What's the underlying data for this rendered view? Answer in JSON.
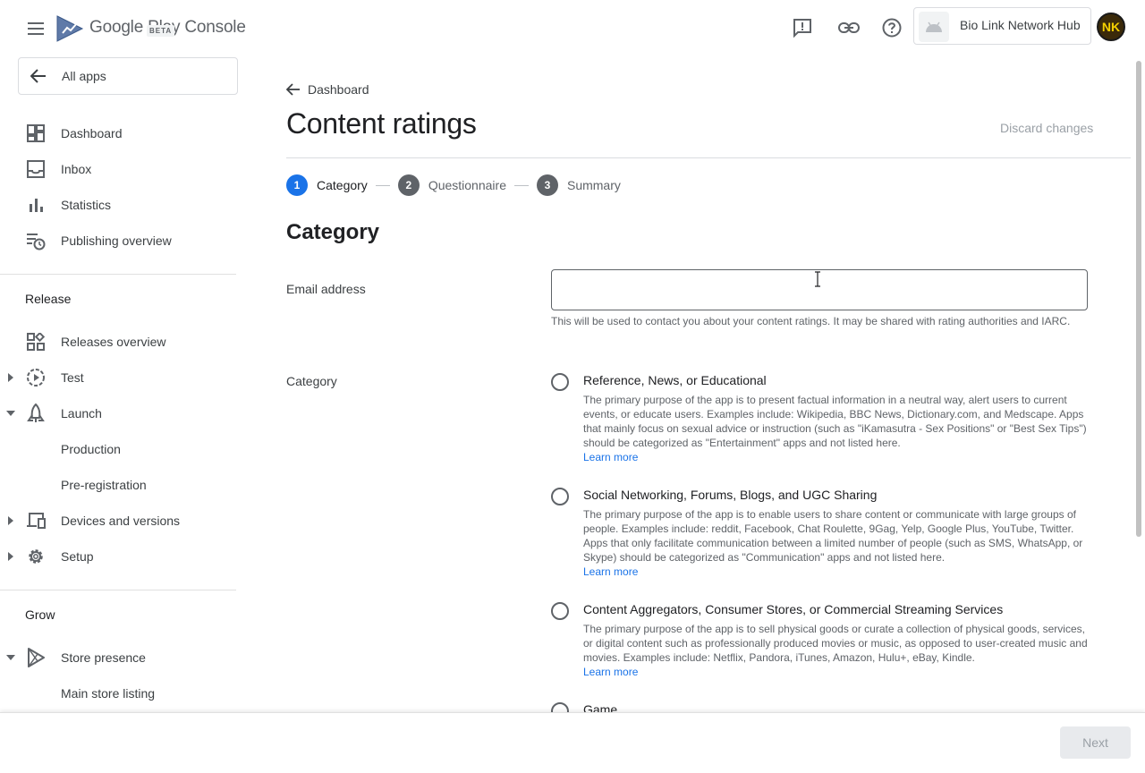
{
  "header": {
    "product_name": "Google Play Console",
    "beta_label": "BETA",
    "app_name": "Bio Link Network Hub",
    "avatar_initials": "NK",
    "icons": [
      "menu-icon",
      "feedback-icon",
      "link-icon",
      "help-icon"
    ]
  },
  "sidebar": {
    "all_apps_label": "All apps",
    "primary_items": [
      {
        "label": "Dashboard",
        "icon": "dashboard-icon"
      },
      {
        "label": "Inbox",
        "icon": "inbox-icon"
      },
      {
        "label": "Statistics",
        "icon": "bar-chart-icon"
      },
      {
        "label": "Publishing overview",
        "icon": "publishing-overview-icon"
      }
    ],
    "release_title": "Release",
    "release_items": [
      {
        "label": "Releases overview",
        "icon": "releases-overview-icon"
      },
      {
        "label": "Test",
        "icon": "test-icon",
        "expandable": true
      },
      {
        "label": "Launch",
        "icon": "launch-icon",
        "expanded": true
      },
      {
        "label": "Production"
      },
      {
        "label": "Pre-registration"
      },
      {
        "label": "Devices and versions",
        "icon": "devices-icon",
        "expandable": true
      },
      {
        "label": "Setup",
        "icon": "gear-icon",
        "expandable": true
      }
    ],
    "grow_title": "Grow",
    "grow_items": [
      {
        "label": "Store presence",
        "icon": "play-icon",
        "expanded": true
      },
      {
        "label": "Main store listing"
      }
    ]
  },
  "main": {
    "breadcrumb": "Dashboard",
    "title": "Content ratings",
    "discard_label": "Discard changes",
    "steps": [
      {
        "num": "1",
        "label": "Category",
        "active": true
      },
      {
        "num": "2",
        "label": "Questionnaire"
      },
      {
        "num": "3",
        "label": "Summary"
      }
    ],
    "section_heading": "Category",
    "email": {
      "label": "Email address",
      "value": "",
      "helper": "This will be used to contact you about your content ratings. It may be shared with rating authorities and IARC."
    },
    "category_label": "Category",
    "options": [
      {
        "title": "Reference, News, or Educational",
        "description": "The primary purpose of the app is to present factual information in a neutral way, alert users to current events, or educate users. Examples include: Wikipedia, BBC News, Dictionary.com, and Medscape. Apps that mainly focus on sexual advice or instruction (such as \"iKamasutra - Sex Positions\" or \"Best Sex Tips\") should be categorized as \"Entertainment\" apps and not listed here.",
        "learn_more": "Learn more"
      },
      {
        "title": "Social Networking, Forums, Blogs, and UGC Sharing",
        "description": "The primary purpose of the app is to enable users to share content or communicate with large groups of people. Examples include: reddit, Facebook, Chat Roulette, 9Gag, Yelp, Google Plus, YouTube, Twitter. Apps that only facilitate communication between a limited number of people (such as SMS, WhatsApp, or Skype) should be categorized as \"Communication\" apps and not listed here.",
        "learn_more": "Learn more"
      },
      {
        "title": "Content Aggregators, Consumer Stores, or Commercial Streaming Services",
        "description": "The primary purpose of the app is to sell physical goods or curate a collection of physical goods, services, or digital content such as professionally produced movies or music, as opposed to user-created music and movies. Examples include: Netflix, Pandora, iTunes, Amazon, Hulu+, eBay, Kindle.",
        "learn_more": "Learn more"
      },
      {
        "title": "Game",
        "description": "",
        "learn_more": ""
      }
    ]
  },
  "footer": {
    "next_label": "Next"
  },
  "colors": {
    "accent": "#1a73e8",
    "text_primary": "#202124",
    "text_secondary": "#5f6368",
    "divider": "#dadce0"
  }
}
